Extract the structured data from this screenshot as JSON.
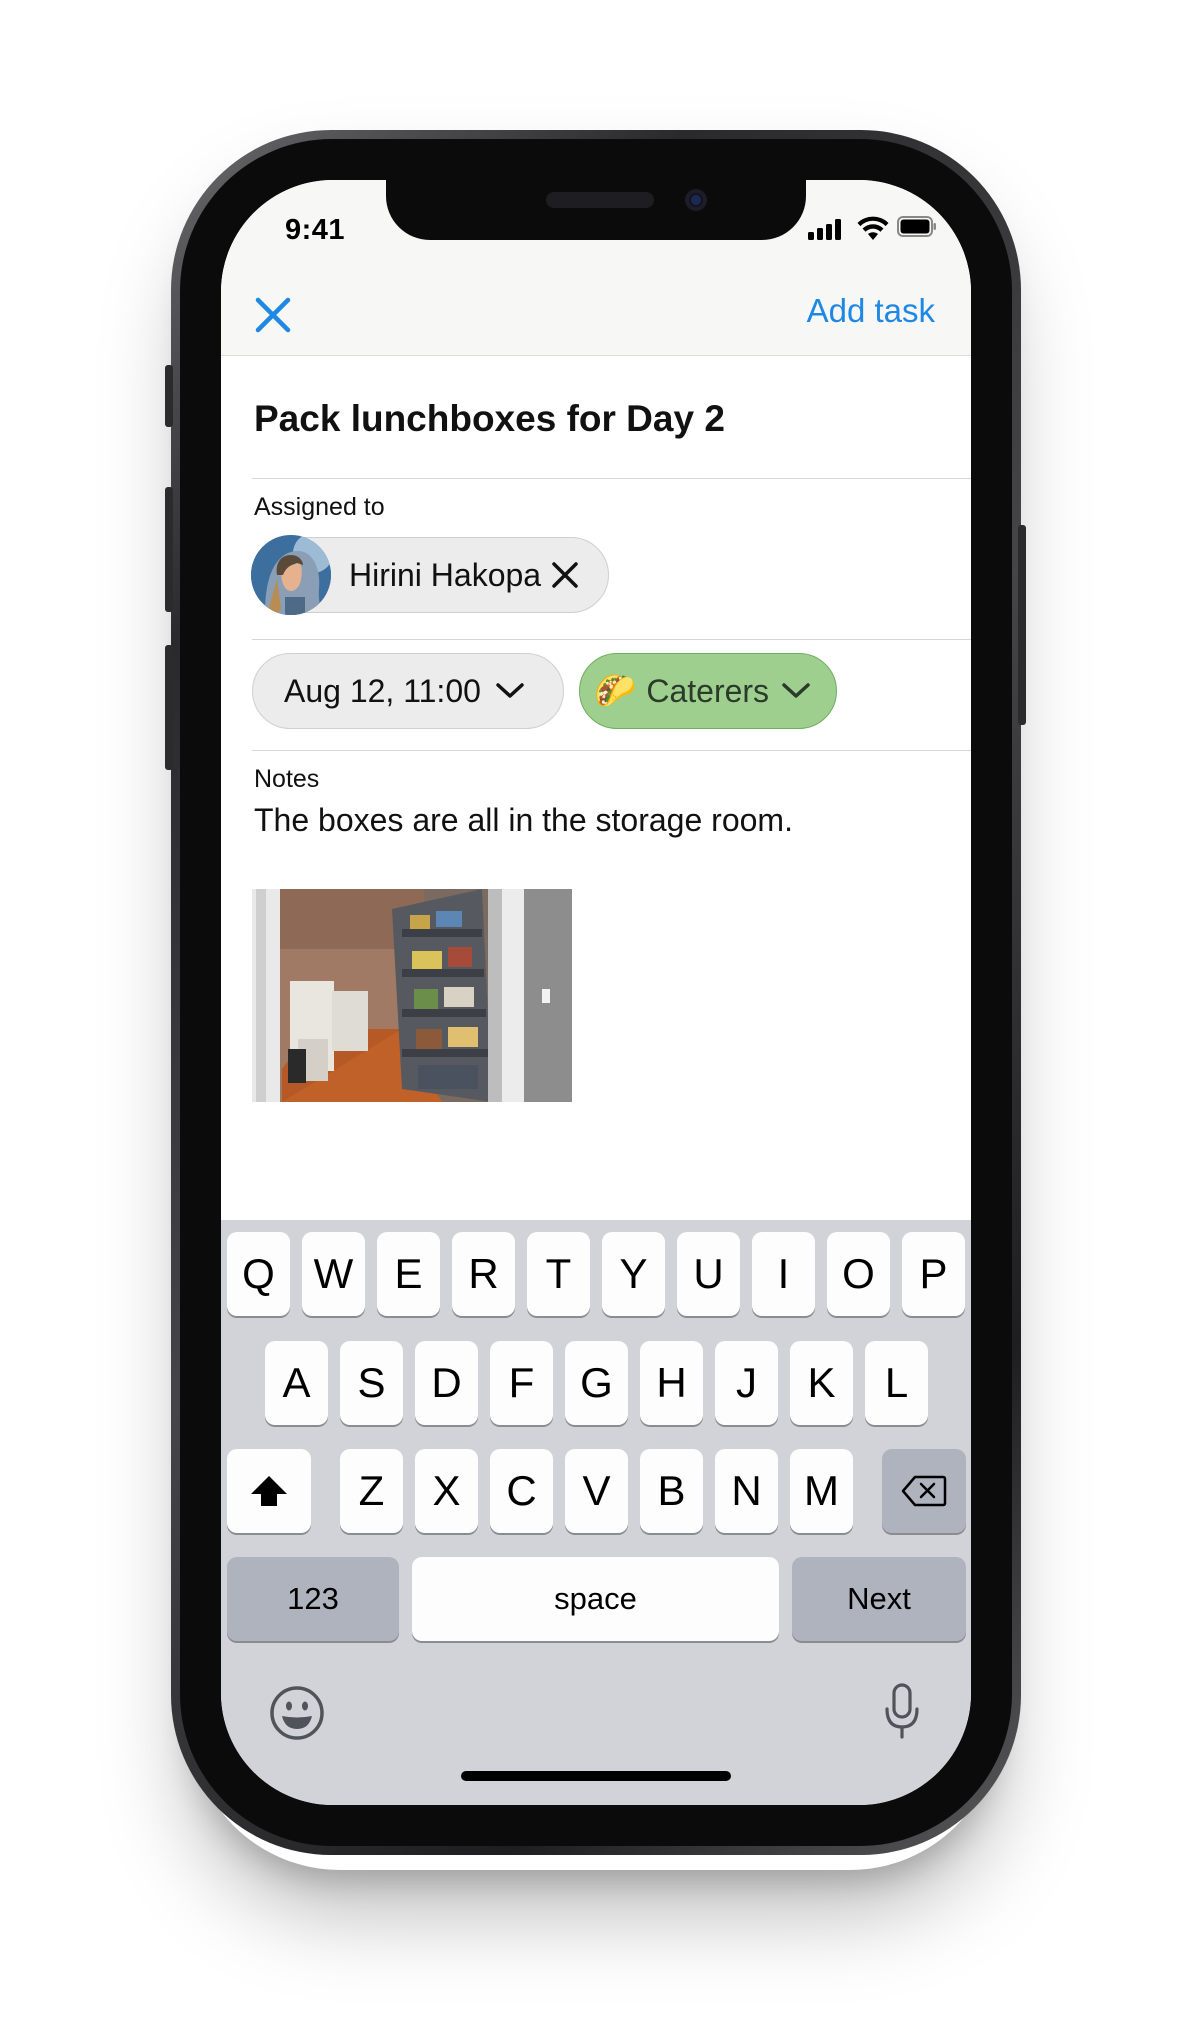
{
  "status_bar": {
    "time": "9:41"
  },
  "header": {
    "primary_action": "Add task"
  },
  "task": {
    "title": "Pack lunchboxes for Day 2"
  },
  "assignee": {
    "label": "Assigned to",
    "name": "Hirini Hakopa"
  },
  "date_chip": {
    "value": "Aug 12, 11:00"
  },
  "category_chip": {
    "emoji": "🌮",
    "label": "Caterers",
    "color": "#9ecf8f"
  },
  "notes": {
    "label": "Notes",
    "text": "The boxes are all in the storage room."
  },
  "accent_color": "#1e88e5",
  "keyboard": {
    "row1": [
      "Q",
      "W",
      "E",
      "R",
      "T",
      "Y",
      "U",
      "I",
      "O",
      "P"
    ],
    "row2": [
      "A",
      "S",
      "D",
      "F",
      "G",
      "H",
      "J",
      "K",
      "L"
    ],
    "row3": [
      "Z",
      "X",
      "C",
      "V",
      "B",
      "N",
      "M"
    ],
    "numbers": "123",
    "space": "space",
    "next": "Next"
  }
}
